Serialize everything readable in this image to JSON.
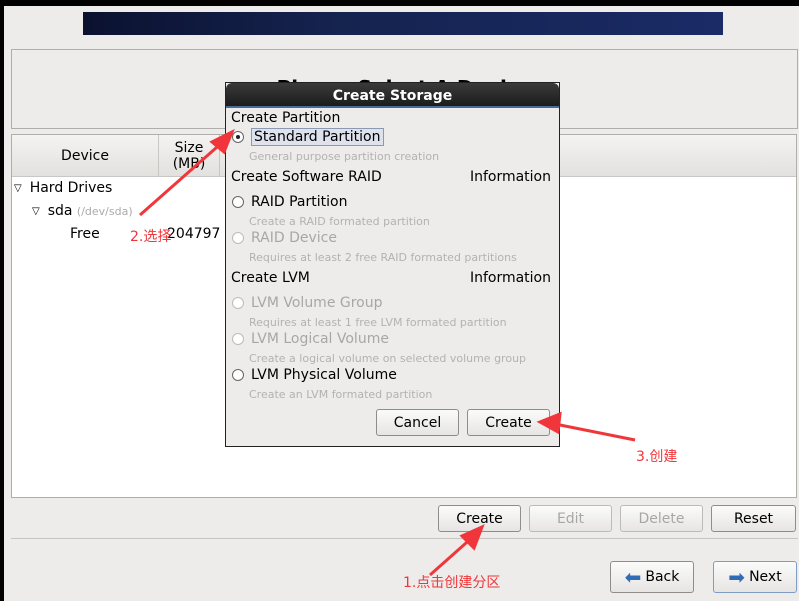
{
  "header": {
    "title": "Please Select A Device"
  },
  "table": {
    "columns": [
      "Device",
      "Size (MB)"
    ],
    "rows": [
      {
        "label": "Hard Drives",
        "level": 0
      },
      {
        "label": "sda",
        "sub": "(/dev/sda)",
        "level": 1
      },
      {
        "label": "Free",
        "size": "204797",
        "level": 2
      }
    ]
  },
  "actions": {
    "create": "Create",
    "edit": "Edit",
    "delete": "Delete",
    "reset": "Reset"
  },
  "nav": {
    "back": "Back",
    "next": "Next"
  },
  "dialog": {
    "title": "Create Storage",
    "sec1": "Create Partition",
    "std": "Standard Partition",
    "std_desc": "General purpose partition creation",
    "sec2": "Create Software RAID",
    "info": "Information",
    "raidp": "RAID Partition",
    "raidp_desc": "Create a RAID formated partition",
    "raidd": "RAID Device",
    "raidd_desc": "Requires at least 2 free RAID formated partitions",
    "sec3": "Create LVM",
    "vg": "LVM Volume Group",
    "vg_desc": "Requires at least 1 free LVM formated partition",
    "lv": "LVM Logical Volume",
    "lv_desc": "Create a logical volume on selected volume group",
    "pv": "LVM Physical Volume",
    "pv_desc": "Create an LVM formated partition",
    "cancel": "Cancel",
    "create": "Create"
  },
  "annotations": {
    "a1": "1.点击创建分区",
    "a2": "2.选择",
    "a3": "3.创建",
    "color": "#f0363a"
  }
}
